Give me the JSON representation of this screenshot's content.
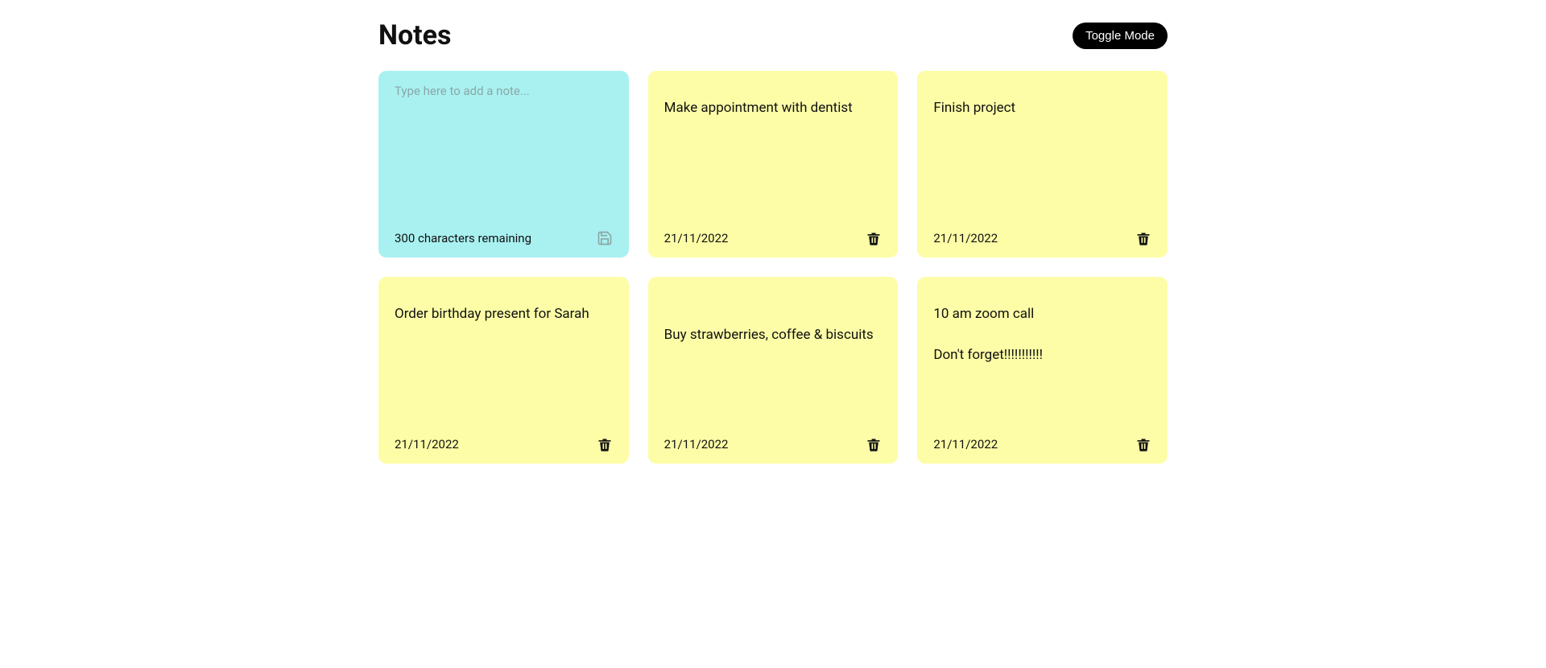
{
  "header": {
    "title": "Notes",
    "toggle_label": "Toggle Mode"
  },
  "new_note": {
    "placeholder": "Type here to add a note...",
    "remaining": "300 characters remaining"
  },
  "notes": [
    {
      "text": "Make appointment with dentist",
      "date": "21/11/2022"
    },
    {
      "text": "Finish project",
      "date": "21/11/2022"
    },
    {
      "text": "Order birthday present for Sarah",
      "date": "21/11/2022"
    },
    {
      "text": "\nBuy strawberries, coffee & biscuits",
      "date": "21/11/2022"
    },
    {
      "text": "10 am zoom call\n\nDon't forget!!!!!!!!!!!",
      "date": "21/11/2022"
    }
  ]
}
